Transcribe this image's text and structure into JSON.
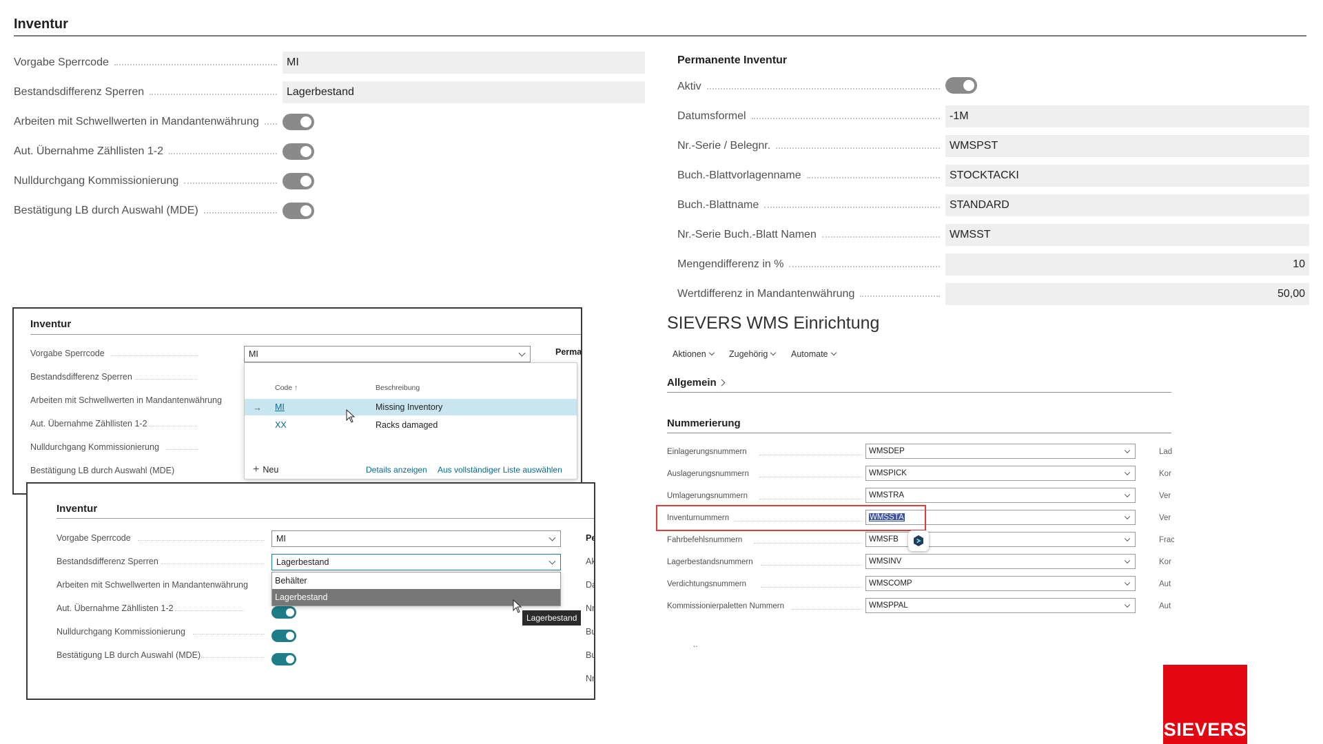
{
  "main": {
    "title": "Inventur",
    "left_fields": [
      {
        "label": "Vorgabe Sperrcode",
        "value": "MI"
      },
      {
        "label": "Bestandsdifferenz Sperren",
        "value": "Lagerbestand"
      }
    ],
    "left_toggles": [
      {
        "label": "Arbeiten mit Schwellwerten in Mandantenwährung",
        "on": true
      },
      {
        "label": "Aut. Übernahme Zähllisten 1-2",
        "on": true
      },
      {
        "label": "Nulldurchgang Kommissionierung",
        "on": true
      },
      {
        "label": "Bestätigung LB durch Auswahl (MDE)",
        "on": true
      }
    ],
    "permanent": {
      "title": "Permanente Inventur",
      "aktiv_label": "Aktiv",
      "fields": [
        {
          "label": "Datumsformel",
          "value": "-1M"
        },
        {
          "label": "Nr.-Serie / Belegnr.",
          "value": "WMSPST"
        },
        {
          "label": "Buch.-Blattvorlagenname",
          "value": "STOCKTACKI"
        },
        {
          "label": "Buch.-Blattname",
          "value": "STANDARD"
        },
        {
          "label": "Nr.-Serie Buch.-Blatt Namen",
          "value": "WMSST"
        },
        {
          "label": "Mengendifferenz in %",
          "value": "10"
        },
        {
          "label": "Wertdifferenz in Mandantenwährung",
          "value": "50,00"
        }
      ]
    }
  },
  "card_a": {
    "title": "Inventur",
    "labels": [
      "Vorgabe Sperrcode",
      "Bestandsdifferenz Sperren",
      "Arbeiten mit Schwellwerten in Mandantenwährung",
      "Aut. Übernahme Zähllisten 1-2",
      "Nulldurchgang Kommissionierung",
      "Bestätigung LB durch Auswahl (MDE)"
    ],
    "select_value": "MI",
    "side_label": "Perma",
    "lookup": {
      "col_code": "Code ↑",
      "col_desc": "Beschreibung",
      "rows": [
        {
          "code": "MI",
          "desc": "Missing Inventory",
          "selected": true
        },
        {
          "code": "XX",
          "desc": "Racks damaged",
          "selected": false
        }
      ],
      "new_label": "Neu",
      "details_label": "Details anzeigen",
      "full_list_label": "Aus vollständiger Liste auswählen"
    }
  },
  "card_b": {
    "title": "Inventur",
    "labels": [
      "Vorgabe Sperrcode",
      "Bestandsdifferenz Sperren",
      "Arbeiten mit Schwellwerten in Mandantenwährung",
      "Aut. Übernahme Zähllisten 1-2",
      "Nulldurchgang Kommissionierung",
      "Bestätigung LB durch Auswahl (MDE)"
    ],
    "sperrcode_value": "MI",
    "bestand_value": "Lagerbestand",
    "options": [
      "Behälter",
      "Lagerbestand"
    ],
    "tooltip": "Lagerbestand",
    "side_labels": [
      "Pe",
      "Ak",
      "Da",
      "Nr",
      "Bu",
      "Bu",
      "Nr"
    ]
  },
  "wms": {
    "title": "SIEVERS WMS Einrichtung",
    "menu": [
      "Aktionen",
      "Zugehörig",
      "Automate"
    ],
    "allgemein": "Allgemein",
    "nummerierung": "Nummerierung",
    "rows": [
      {
        "label": "Einlagerungsnummern",
        "value": "WMSDEP",
        "side": "Lad"
      },
      {
        "label": "Auslagerungsnummern",
        "value": "WMSPICK",
        "side": "Kor"
      },
      {
        "label": "Umlagerungsnummern",
        "value": "WMSTRA",
        "side": "Ver"
      },
      {
        "label": "Inventurnummern",
        "value": "WMSSTA",
        "side": "Ver"
      },
      {
        "label": "Fahrbefehlsnummern",
        "value": "WMSFB",
        "side": "Frac"
      },
      {
        "label": "Lagerbestandsnummern",
        "value": "WMSINV",
        "side": "Kor"
      },
      {
        "label": "Verdichtungsnummern",
        "value": "WMSCOMP",
        "side": "Aut"
      },
      {
        "label": "Kommissionierpaletten Nummern",
        "value": "WMSPPAL",
        "side": "Aut"
      }
    ],
    "ellipsis": ".."
  },
  "logo": {
    "text": "SIEVERS",
    "color": "#e30613"
  },
  "colors": {
    "accent": "#1e7d86",
    "toggle_off_gray": "#8a8a8a",
    "highlight_box": "#e03a3a"
  }
}
